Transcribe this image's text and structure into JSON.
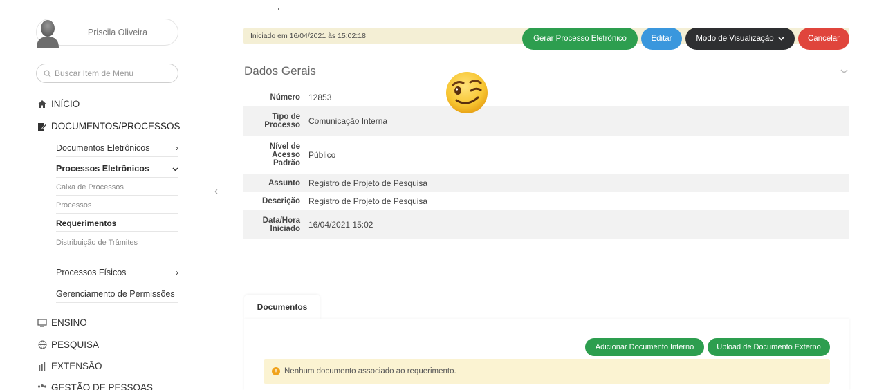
{
  "user": {
    "name": "Priscila Oliveira"
  },
  "search": {
    "placeholder": "Buscar Item de Menu"
  },
  "menu": {
    "inicio": "INÍCIO",
    "documentos_processos": "DOCUMENTOS/PROCESSOS",
    "documentos_eletronicos": "Documentos Eletrônicos",
    "processos_eletronicos": "Processos Eletrônicos",
    "caixa_de_processos": "Caixa de Processos",
    "processos": "Processos",
    "requerimentos": "Requerimentos",
    "distribuicao_de_tramites": "Distribuição de Trâmites",
    "processos_fisicos": "Processos Físicos",
    "gerenciamento_de_permissoes": "Gerenciamento de Permissões",
    "ensino": "ENSINO",
    "pesquisa": "PESQUISA",
    "extensao": "EXTENSÃO",
    "gestao_de_pessoas": "GESTÃO DE PESSOAS"
  },
  "status": {
    "text": "Iniciado em 16/04/2021 às 15:02:18"
  },
  "actions": {
    "gerar": "Gerar Processo Eletrônico",
    "editar": "Editar",
    "modo": "Modo de Visualização",
    "cancelar": "Cancelar"
  },
  "dados_gerais": {
    "title": "Dados Gerais",
    "rows": [
      {
        "label": "Número",
        "value": "12853"
      },
      {
        "label": "Tipo de\nProcesso",
        "value": "Comunicação Interna"
      },
      {
        "label": "Nível de\nAcesso\nPadrão",
        "value": "Público"
      },
      {
        "label": "Assunto",
        "value": "Registro de Projeto de Pesquisa"
      },
      {
        "label": "Descrição",
        "value": "Registro de Projeto de Pesquisa"
      },
      {
        "label": "Data/Hora\nIniciado",
        "value": "16/04/2021 15:02"
      }
    ]
  },
  "documentos": {
    "tab": "Documentos",
    "add_interno": "Adicionar Documento Interno",
    "upload_externo": "Upload de Documento Externo",
    "empty_message": "Nenhum documento associado ao requerimento."
  },
  "colors": {
    "green": "#2d9e4f",
    "blue": "#3a97dd",
    "dark": "#2e2f31",
    "red": "#e0453c",
    "status_bg": "#f4efd5",
    "warning_bg": "#fbf3d2"
  }
}
